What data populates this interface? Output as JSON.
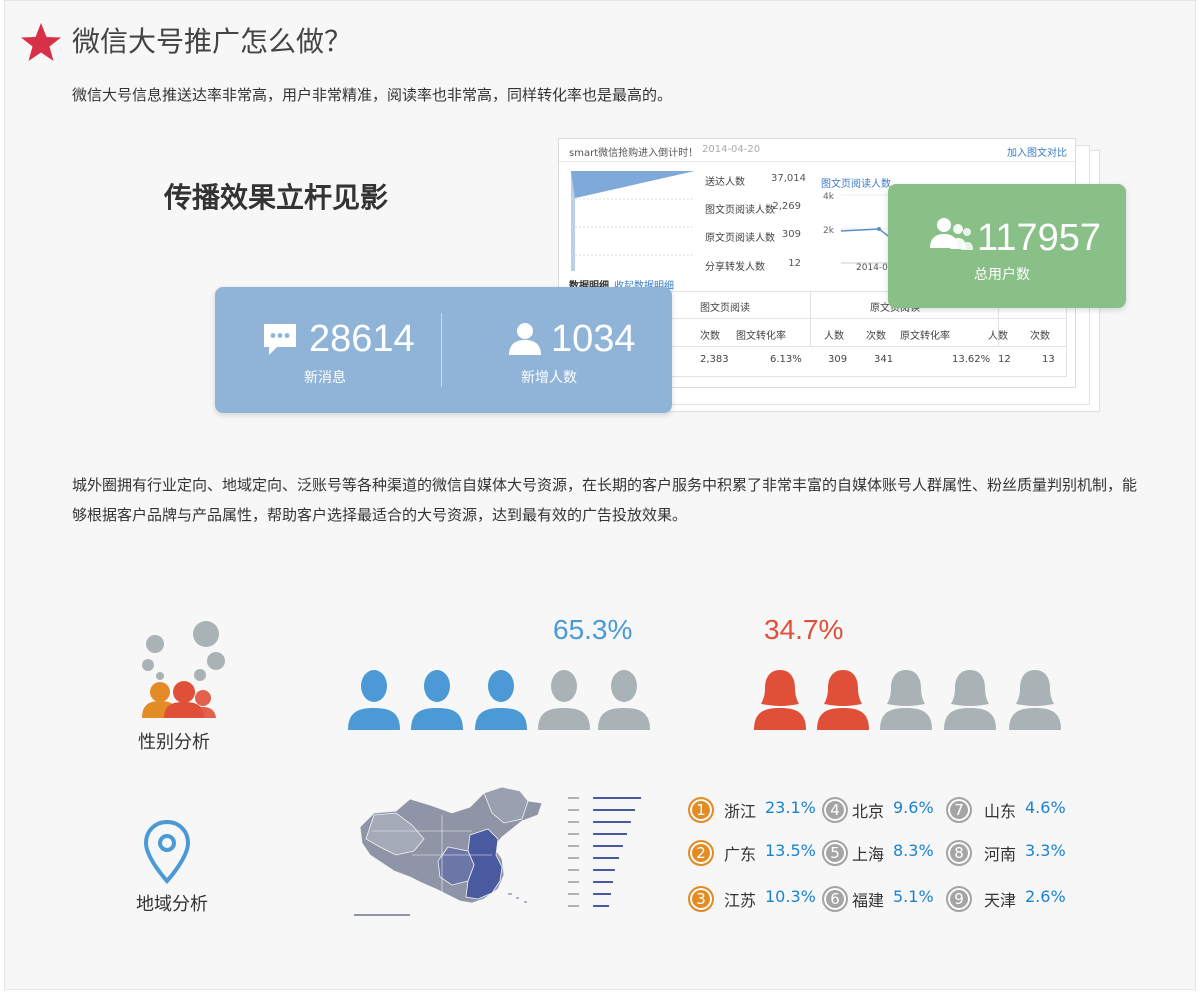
{
  "header": {
    "title": "微信大号推广怎么做？"
  },
  "intro": "微信大号信息推送达率非常高，用户非常精准，阅读率也非常高，同样转化率也是最高的。",
  "slogan": "传播效果立杆见影",
  "dashboard": {
    "title": "smart微信抢购进入倒计时！",
    "date": "2014-04-20",
    "compare_link": "加入图文对比",
    "funnel": [
      {
        "label": "送达人数",
        "value": "37,014"
      },
      {
        "label": "图文页阅读人数",
        "value": "2,269"
      },
      {
        "label": "原文页阅读人数",
        "value": "309"
      },
      {
        "label": "分享转发人数",
        "value": "12"
      }
    ],
    "chart_title": "图文页阅读人数",
    "chart_ticks": [
      "4k",
      "2k"
    ],
    "chart_date": "2014-04",
    "table_caption": "数据明细",
    "table_link": "收起数据明细",
    "table_groups": [
      "图文页阅读",
      "原文页阅读"
    ],
    "table_headers": [
      "次数",
      "图文转化率",
      "人数",
      "次数",
      "原文转化率",
      "人数",
      "次数"
    ],
    "table_row": [
      "2,383",
      "6.13%",
      "309",
      "341",
      "13.62%",
      "12",
      "13"
    ]
  },
  "stats": {
    "messages": {
      "value": "28614",
      "label": "新消息"
    },
    "new_users": {
      "value": "1034",
      "label": "新增人数"
    },
    "total_users": {
      "value": "117957",
      "label": "总用户数"
    }
  },
  "description": "城外圈拥有行业定向、地域定向、泛账号等各种渠道的微信自媒体大号资源，在长期的客户服务中积累了非常丰富的自媒体账号人群属性、粉丝质量判别机制，能够根据客户品牌与产品属性，帮助客户选择最适合的大号资源，达到最有效的广告投放效果。",
  "gender": {
    "label": "性别分析",
    "male_pct": "65.3%",
    "female_pct": "34.7%",
    "male_value": 0.653,
    "female_value": 0.347
  },
  "region": {
    "label": "地域分析",
    "items": [
      {
        "rank": "1",
        "name": "浙江",
        "pct": "23.1%"
      },
      {
        "rank": "2",
        "name": "广东",
        "pct": "13.5%"
      },
      {
        "rank": "3",
        "name": "江苏",
        "pct": "10.3%"
      },
      {
        "rank": "4",
        "name": "北京",
        "pct": "9.6%"
      },
      {
        "rank": "5",
        "name": "上海",
        "pct": "8.3%"
      },
      {
        "rank": "6",
        "name": "福建",
        "pct": "5.1%"
      },
      {
        "rank": "7",
        "name": "山东",
        "pct": "4.6%"
      },
      {
        "rank": "8",
        "name": "河南",
        "pct": "3.3%"
      },
      {
        "rank": "9",
        "name": "天津",
        "pct": "2.6%"
      }
    ]
  },
  "colors": {
    "star": "#d9304a",
    "male": "#4b9ad6",
    "female": "#e05038",
    "gray": "#a9b3b5",
    "top_rank": "#e38c26",
    "other_rank": "#a5a5a5",
    "pct_blue": "#1a82d0",
    "map_dark": "#4a5aa0",
    "map_light": "#8f95a6"
  }
}
